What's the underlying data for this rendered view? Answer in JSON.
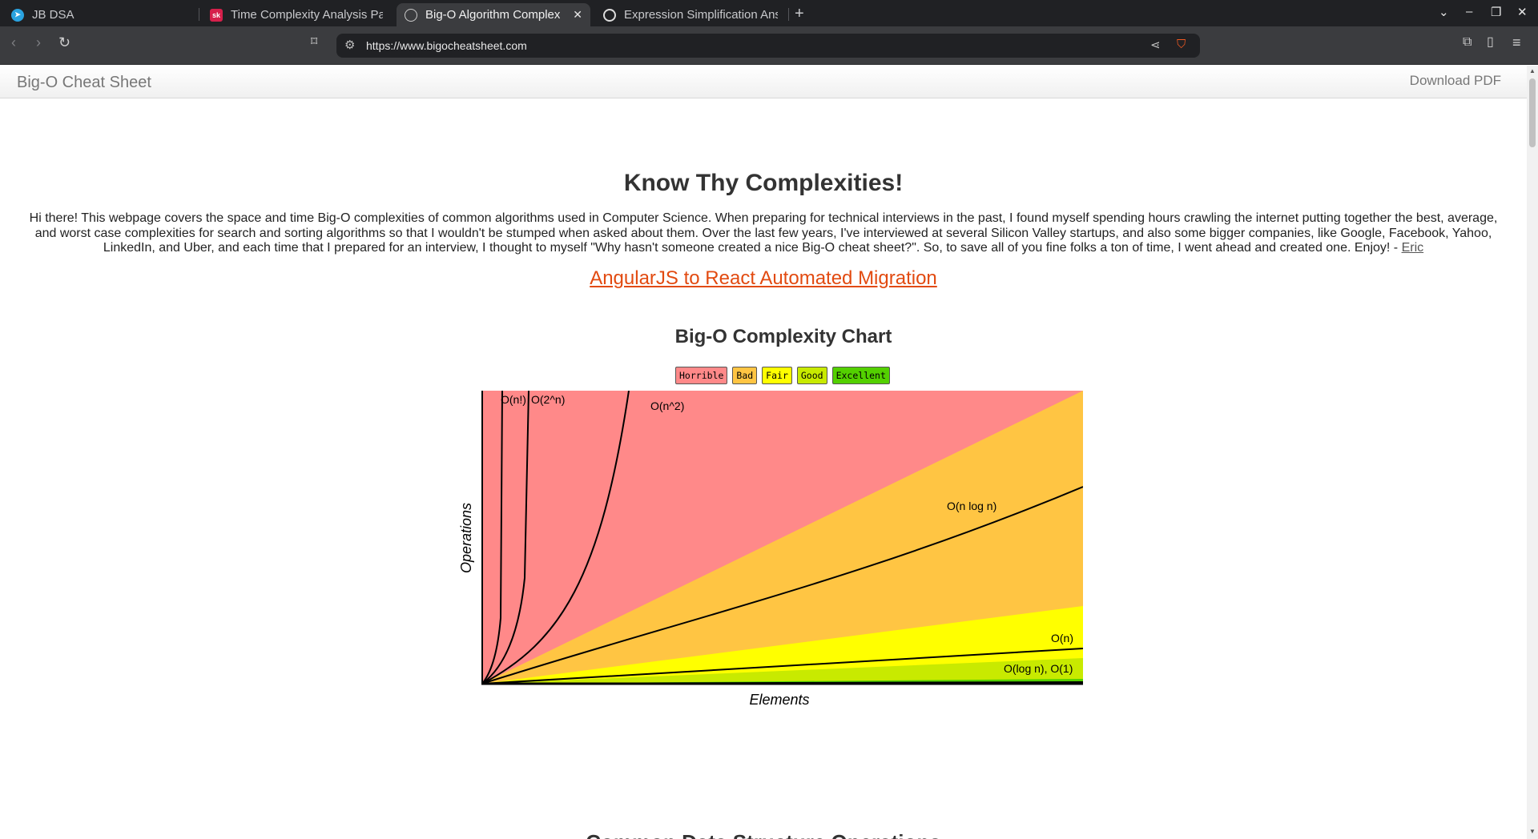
{
  "browser": {
    "tabs": [
      {
        "label": "JB DSA",
        "icon": "telegram-icon"
      },
      {
        "label": "Time Complexity Analysis Pa",
        "icon": "sk-icon"
      },
      {
        "label": "Big-O Algorithm Complex",
        "icon": "globe-icon",
        "active": true
      },
      {
        "label": "Expression Simplification Ans",
        "icon": "openai-icon"
      }
    ],
    "new_tab": "+",
    "url": "https://www.bigocheatsheet.com"
  },
  "nav": {
    "brand": "Big-O Cheat Sheet",
    "download": "Download PDF"
  },
  "content": {
    "title": "Know Thy Complexities!",
    "intro": "Hi there!  This webpage covers the space and time Big-O complexities of common algorithms used in Computer Science.  When preparing for technical interviews in the past, I found myself spending hours crawling the internet putting together the best, average, and worst case complexities for search and sorting algorithms so that I wouldn't be stumped when asked about them.  Over the last few years, I've interviewed at several Silicon Valley startups, and also some bigger companies, like Google, Facebook, Yahoo, LinkedIn, and Uber, and each time that I prepared for an interview, I thought to myself \"Why hasn't someone created a nice Big-O cheat sheet?\".  So, to save all of you fine folks a ton of time, I went ahead and created one.  Enjoy! - ",
    "author_link": "Eric",
    "promo_link": "AngularJS to React Automated Migration",
    "chart_heading": "Big-O Complexity Chart",
    "next_heading": "Common Data Structure Operations"
  },
  "legend": [
    {
      "label": "Horrible",
      "color": "#ff8989"
    },
    {
      "label": "Bad",
      "color": "#ffc543"
    },
    {
      "label": "Fair",
      "color": "#ffff00"
    },
    {
      "label": "Good",
      "color": "#c8ea00"
    },
    {
      "label": "Excellent",
      "color": "#53d000"
    }
  ],
  "chart_data": {
    "type": "line",
    "xlabel": "Elements",
    "ylabel": "Operations",
    "regions": [
      {
        "name": "Horrible",
        "color": "#ff8989"
      },
      {
        "name": "Bad",
        "color": "#ffc543"
      },
      {
        "name": "Fair",
        "color": "#ffff00"
      },
      {
        "name": "Good",
        "color": "#c8ea00"
      },
      {
        "name": "Excellent",
        "color": "#53d000"
      }
    ],
    "curves": [
      {
        "label": "O(n!)"
      },
      {
        "label": "O(2^n)"
      },
      {
        "label": "O(n^2)"
      },
      {
        "label": "O(n log n)"
      },
      {
        "label": "O(n)"
      },
      {
        "label": "O(log n), O(1)"
      }
    ]
  }
}
